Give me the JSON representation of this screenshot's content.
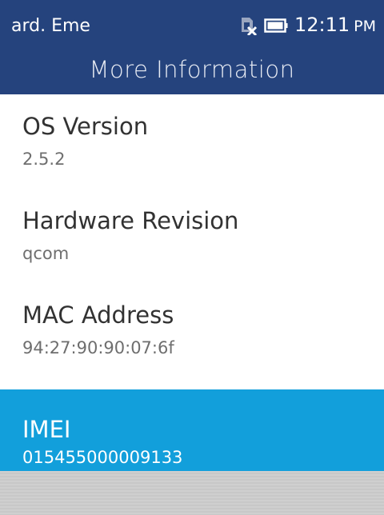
{
  "status_bar": {
    "carrier": "ard. Eme",
    "sim_icon": "no-sim-icon",
    "battery_icon": "battery-icon",
    "time": "12:11",
    "ampm": "PM"
  },
  "header": {
    "title": "More Information"
  },
  "items": [
    {
      "label": "OS Version",
      "value": "2.5.2"
    },
    {
      "label": "Hardware Revision",
      "value": "qcom"
    },
    {
      "label": "MAC Address",
      "value": "94:27:90:90:07:6f"
    },
    {
      "label": "IMEI",
      "value": "015455000009133"
    }
  ],
  "selected_index": 3,
  "colors": {
    "header_bg": "#25437d",
    "selected_bg": "#129fdb",
    "softkey_bg": "#cfcfcf"
  }
}
